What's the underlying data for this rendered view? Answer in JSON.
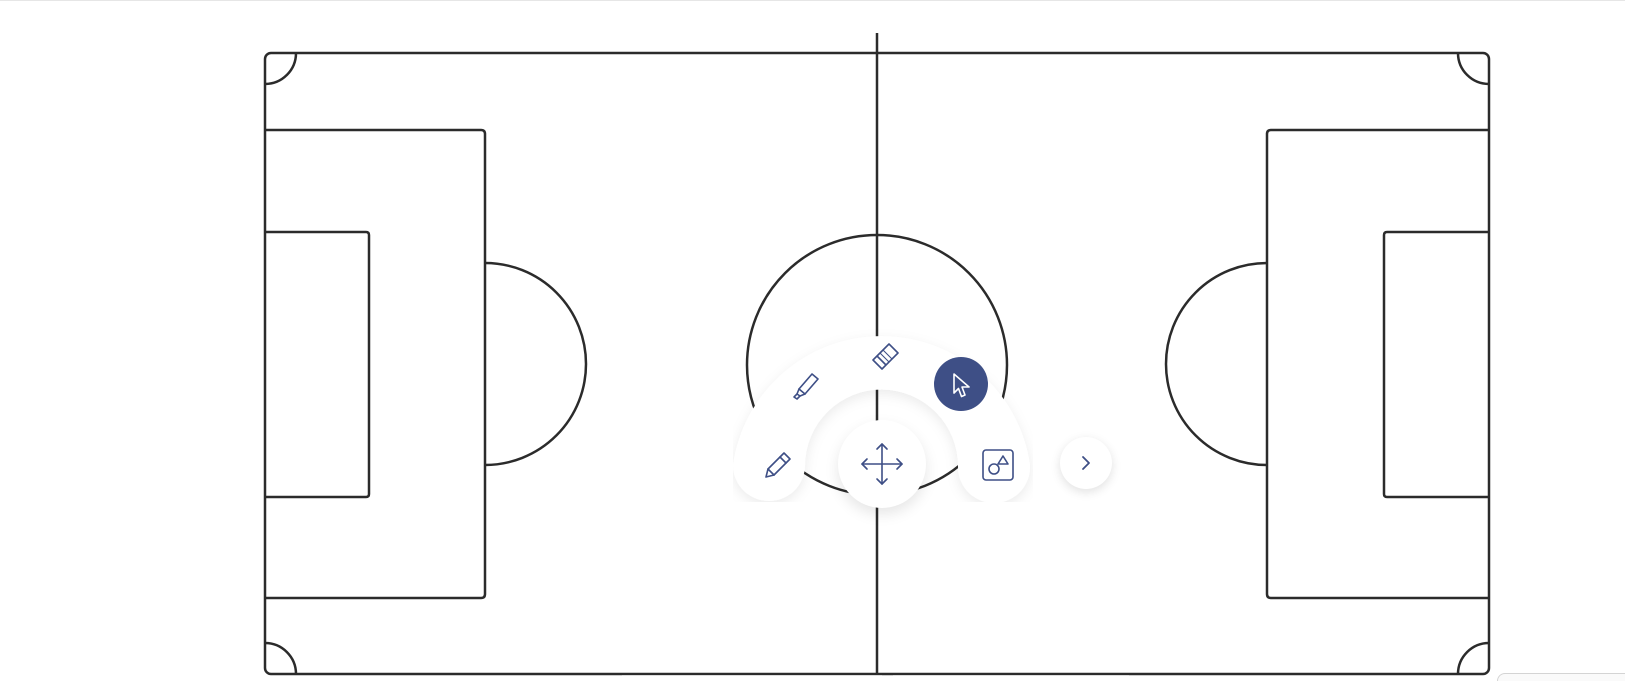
{
  "app": {
    "accent_color": "#3e4f86",
    "icon_color": "#3e4f86",
    "line_color": "#2b2b2b",
    "background_color": "#ffffff"
  },
  "pitch": {
    "type": "soccer-field-diagram",
    "orientation": "horizontal"
  },
  "toolbar": {
    "active_tool": "select",
    "tools": [
      {
        "id": "highlighter",
        "icon": "highlighter-icon",
        "active": false
      },
      {
        "id": "eraser",
        "icon": "eraser-icon",
        "active": false
      },
      {
        "id": "select",
        "icon": "cursor-arrow-icon",
        "active": true
      },
      {
        "id": "pencil",
        "icon": "pencil-icon",
        "active": false
      },
      {
        "id": "move",
        "icon": "move-arrows-icon",
        "active": false
      },
      {
        "id": "shapes",
        "icon": "shapes-icon",
        "active": false
      },
      {
        "id": "more",
        "icon": "chevron-right-icon",
        "active": false
      }
    ]
  }
}
